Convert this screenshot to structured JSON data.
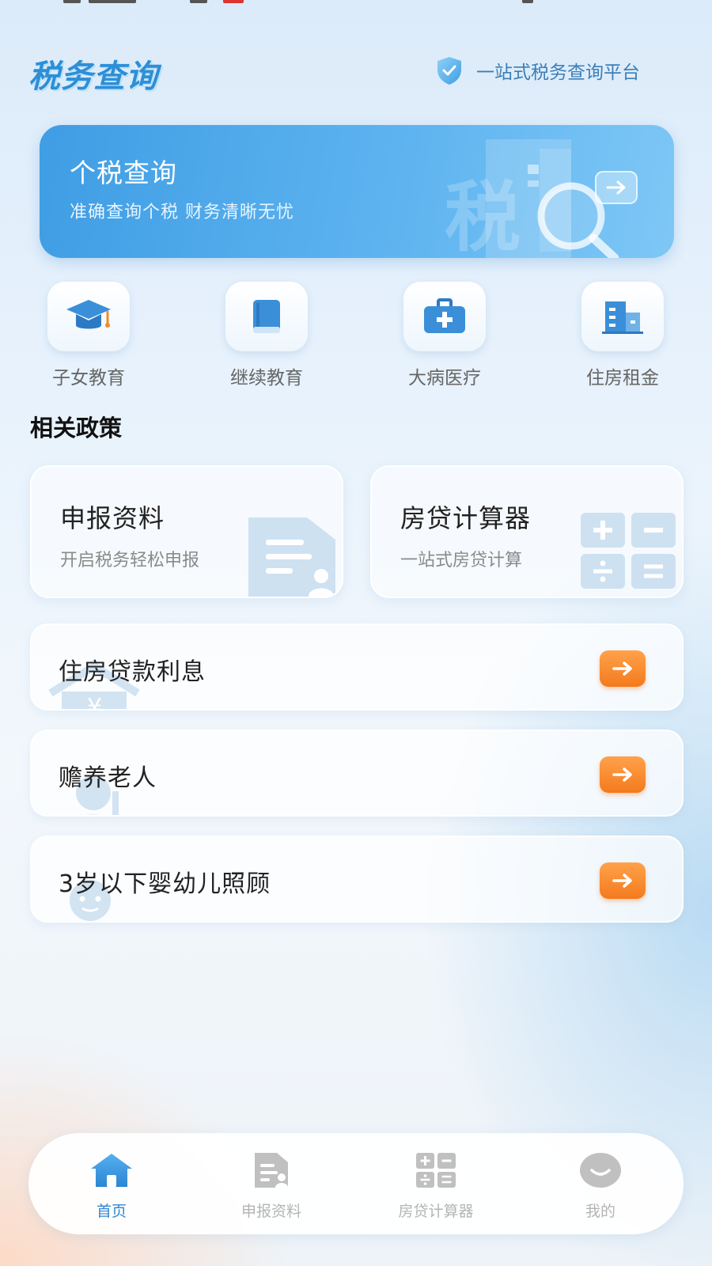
{
  "header": {
    "app_title": "税务查询",
    "slogan": "一站式税务查询平台"
  },
  "banner": {
    "title": "个税查询",
    "subtitle": "准确查询个税 财务清晰无忧",
    "art_text": "税"
  },
  "categories": [
    {
      "label": "子女教育",
      "icon": "graduation-cap-icon"
    },
    {
      "label": "继续教育",
      "icon": "book-icon"
    },
    {
      "label": "大病医疗",
      "icon": "medical-kit-icon"
    },
    {
      "label": "住房租金",
      "icon": "building-icon"
    }
  ],
  "policy": {
    "section_title": "相关政策",
    "cards": [
      {
        "title": "申报资料",
        "subtitle": "开启税务轻松申报",
        "icon": "document-icon"
      },
      {
        "title": "房贷计算器",
        "subtitle": "一站式房贷计算",
        "icon": "calculator-icon"
      }
    ],
    "rows": [
      {
        "label": "住房贷款利息",
        "icon": "house-yuan-icon"
      },
      {
        "label": "赡养老人",
        "icon": "elder-icon"
      },
      {
        "label": "3岁以下婴幼儿照顾",
        "icon": "baby-icon"
      }
    ]
  },
  "tabbar": {
    "items": [
      {
        "label": "首页",
        "icon": "home-icon",
        "active": true
      },
      {
        "label": "申报资料",
        "icon": "document-icon",
        "active": false
      },
      {
        "label": "房贷计算器",
        "icon": "calculator-icon",
        "active": false
      },
      {
        "label": "我的",
        "icon": "smile-icon",
        "active": false
      }
    ]
  },
  "colors": {
    "accent": "#2c86d3",
    "banner": "#4aa6e8",
    "arrow_button": "#f58a2a",
    "inactive_tab": "#b4b4b4"
  }
}
